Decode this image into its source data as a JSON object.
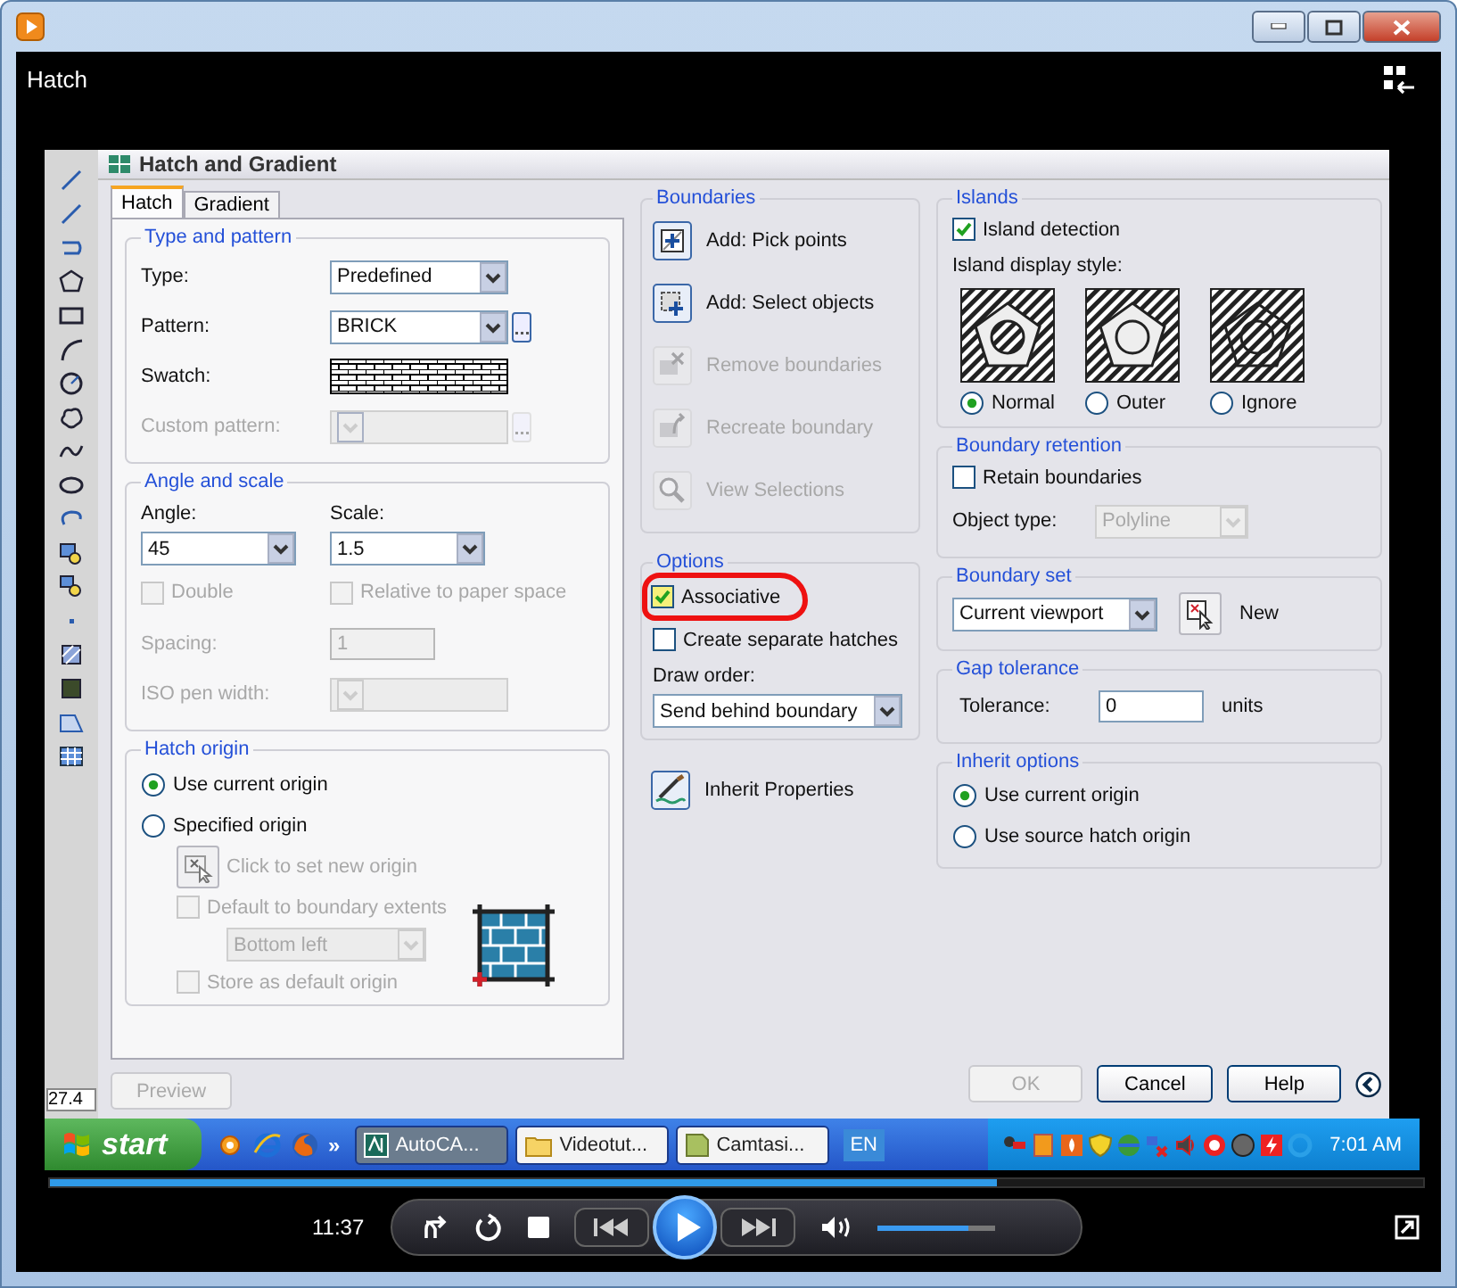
{
  "player": {
    "title": "Hatch"
  },
  "dialog": {
    "title": "Hatch and Gradient",
    "tabs": [
      {
        "label": "Hatch",
        "selected": true
      },
      {
        "label": "Gradient",
        "selected": false
      }
    ],
    "type_and_pattern": {
      "title": "Type and pattern",
      "fields": [
        {
          "kind": "dropdown",
          "label": "Type:",
          "value": "Predefined",
          "disabled": false
        },
        {
          "kind": "dropdown-browse",
          "label": "Pattern:",
          "value": "BRICK",
          "disabled": false
        },
        {
          "kind": "swatch",
          "label": "Swatch:",
          "disabled": false
        },
        {
          "kind": "dropdown-browse",
          "label": "Custom pattern:",
          "disabled": true
        }
      ]
    },
    "angle_and_scale": {
      "title": "Angle and scale",
      "angle": {
        "label": "Angle:",
        "value": "45"
      },
      "scale": {
        "label": "Scale:",
        "value": "1.5"
      },
      "checks": [
        {
          "label": "Double",
          "checked": false,
          "disabled": true
        },
        {
          "label": "Relative to paper space",
          "checked": false,
          "disabled": true
        }
      ],
      "spacing": {
        "label": "Spacing:",
        "value": "1",
        "disabled": true
      },
      "iso_pen_width": {
        "label": "ISO pen width:",
        "disabled": true
      }
    },
    "hatch_origin": {
      "title": "Hatch origin",
      "options": [
        {
          "label": "Use current origin",
          "selected": true
        },
        {
          "label": "Specified origin",
          "selected": false
        }
      ],
      "set_origin": {
        "label": "Click to set new origin",
        "disabled": true
      },
      "default_extents": {
        "label": "Default to boundary extents",
        "checked": false,
        "disabled": true
      },
      "position": {
        "value": "Bottom left",
        "disabled": true
      },
      "store_default": {
        "label": "Store as default origin",
        "checked": false,
        "disabled": true
      }
    },
    "preview_button": {
      "label": "Preview",
      "disabled": true
    },
    "boundaries": {
      "title": "Boundaries",
      "buttons": [
        {
          "kind": "pick",
          "label": "Add: Pick points",
          "disabled": false
        },
        {
          "kind": "select",
          "label": "Add: Select objects",
          "disabled": false
        },
        {
          "kind": "remove",
          "label": "Remove boundaries",
          "disabled": true
        },
        {
          "kind": "recreate",
          "label": "Recreate boundary",
          "disabled": true
        },
        {
          "kind": "view",
          "label": "View Selections",
          "disabled": true
        }
      ]
    },
    "options": {
      "title": "Options",
      "checks": [
        {
          "label": "Associative",
          "checked": true
        },
        {
          "label": "Create separate hatches",
          "checked": false
        }
      ],
      "draw_order": {
        "label": "Draw order:",
        "value": "Send behind boundary"
      }
    },
    "inherit_button": {
      "label": "Inherit Properties"
    },
    "islands": {
      "title": "Islands",
      "detection": {
        "label": "Island detection",
        "checked": true
      },
      "style_label": "Island display style:",
      "styles": [
        {
          "kind": "normal",
          "label": "Normal",
          "selected": true
        },
        {
          "kind": "outer",
          "label": "Outer",
          "selected": false
        },
        {
          "kind": "ignore",
          "label": "Ignore",
          "selected": false
        }
      ]
    },
    "boundary_retention": {
      "title": "Boundary retention",
      "retain": {
        "label": "Retain boundaries",
        "checked": false
      },
      "object_type": {
        "label": "Object type:",
        "value": "Polyline",
        "disabled": true
      }
    },
    "boundary_set": {
      "title": "Boundary set",
      "value": "Current viewport",
      "new_label": "New"
    },
    "gap_tolerance": {
      "title": "Gap tolerance",
      "label": "Tolerance:",
      "value": "0",
      "unit": "units"
    },
    "inherit_options": {
      "title": "Inherit options",
      "options": [
        {
          "label": "Use current origin",
          "selected": true
        },
        {
          "label": "Use source hatch origin",
          "selected": false
        }
      ]
    },
    "footer_buttons": [
      {
        "label": "OK",
        "disabled": true
      },
      {
        "label": "Cancel",
        "disabled": false
      },
      {
        "label": "Help",
        "disabled": false
      }
    ]
  },
  "autocad": {
    "coordinate": "27.4"
  },
  "taskbar": {
    "start": "start",
    "chevron": "»",
    "tasks": [
      {
        "kind": "autocad",
        "label": "AutoCA...",
        "selected": true
      },
      {
        "kind": "folder",
        "label": "Videotut...",
        "selected": false
      },
      {
        "kind": "camtasia",
        "label": "Camtasi...",
        "selected": false
      }
    ],
    "language": "EN",
    "clock": "7:01 AM"
  },
  "controls": {
    "time": "11:37",
    "progress": {
      "level": 0.69
    },
    "volume": {
      "level": 0.78
    }
  }
}
